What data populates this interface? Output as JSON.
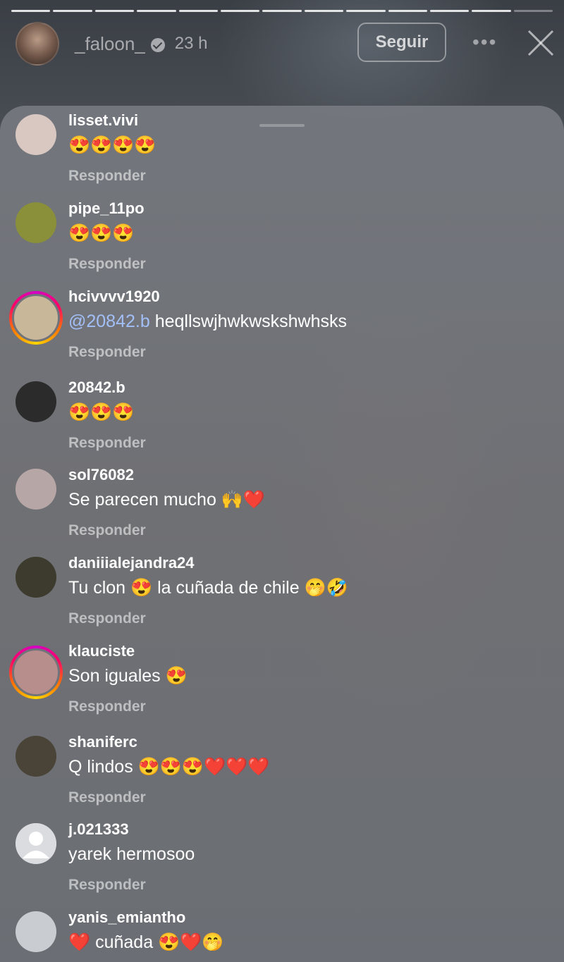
{
  "story": {
    "username": "_faloon_",
    "time": "23 h",
    "follow_label": "Seguir",
    "more_icon": "ellipsis-icon",
    "close_icon": "close-icon"
  },
  "comments": [
    {
      "username": "lisset.vivi",
      "text": "😍😍😍😍",
      "reply": "Responder",
      "avatar_color": "#d9c8c2",
      "story_ring": false
    },
    {
      "username": "pipe_11po",
      "text": "😍😍😍",
      "reply": "Responder",
      "avatar_color": "#8a8f3a",
      "story_ring": false
    },
    {
      "username": "hcivvvv1920",
      "mention": "@20842.b",
      "text": "heqllswjhwkwskshwhsks",
      "reply": "Responder",
      "avatar_color": "#c9b79a",
      "story_ring": true
    },
    {
      "username": "20842.b",
      "text": "😍😍😍",
      "reply": "Responder",
      "avatar_color": "#2b2b2b",
      "story_ring": false
    },
    {
      "username": "sol76082",
      "text": "Se parecen mucho 🙌❤️",
      "reply": "Responder",
      "avatar_color": "#b7a6a6",
      "story_ring": false
    },
    {
      "username": "daniiialejandra24",
      "text": "Tu clon 😍 la cuñada de chile 🤭🤣",
      "reply": "Responder",
      "avatar_color": "#3d3a2e",
      "story_ring": false
    },
    {
      "username": "klauciste",
      "text": "Son iguales 😍",
      "reply": "Responder",
      "avatar_color": "#b88e8c",
      "story_ring": true
    },
    {
      "username": "shaniferc",
      "text": "Q lindos 😍😍😍❤️❤️❤️",
      "reply": "Responder",
      "avatar_color": "#4a4438",
      "story_ring": false
    },
    {
      "username": "j.021333",
      "text": "yarek hermosoo",
      "reply": "Responder",
      "avatar_color": "#dadce0",
      "story_ring": false,
      "default_avatar": true
    },
    {
      "username": "yanis_emiantho",
      "text": "❤️ cuñada 😍❤️🤭",
      "reply": "",
      "avatar_color": "#c9ccd0",
      "story_ring": false
    }
  ]
}
